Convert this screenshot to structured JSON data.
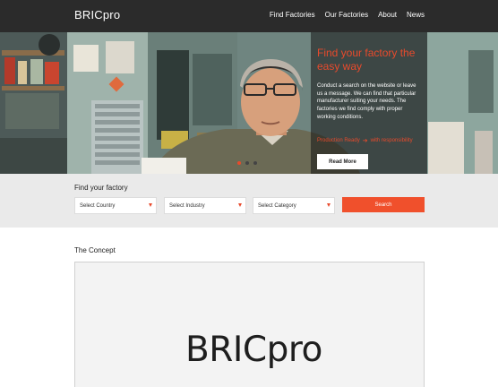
{
  "nav": {
    "brand": "BRICpro",
    "items": [
      {
        "label": "Find Factories"
      },
      {
        "label": "Our Factories"
      },
      {
        "label": "About"
      },
      {
        "label": "News"
      }
    ]
  },
  "hero": {
    "title": "Find your factory the easy way",
    "text": "Conduct a search on the website or leave us a message. We can find that particular manufacturer suiting your needs. The factories we find comply with proper working conditions.",
    "link_left": "Production Ready",
    "link_right": "with responsibility",
    "button": "Read More",
    "slides": 3,
    "active_slide": 1
  },
  "search": {
    "title": "Find your factory",
    "country": "Select Country",
    "industry": "Select Industry",
    "category": "Select Category",
    "button": "Search"
  },
  "concept": {
    "title": "The Concept",
    "logo_text": "BRICpro"
  },
  "colors": {
    "accent": "#f0502c",
    "nav_bg": "#2b2b2b"
  }
}
